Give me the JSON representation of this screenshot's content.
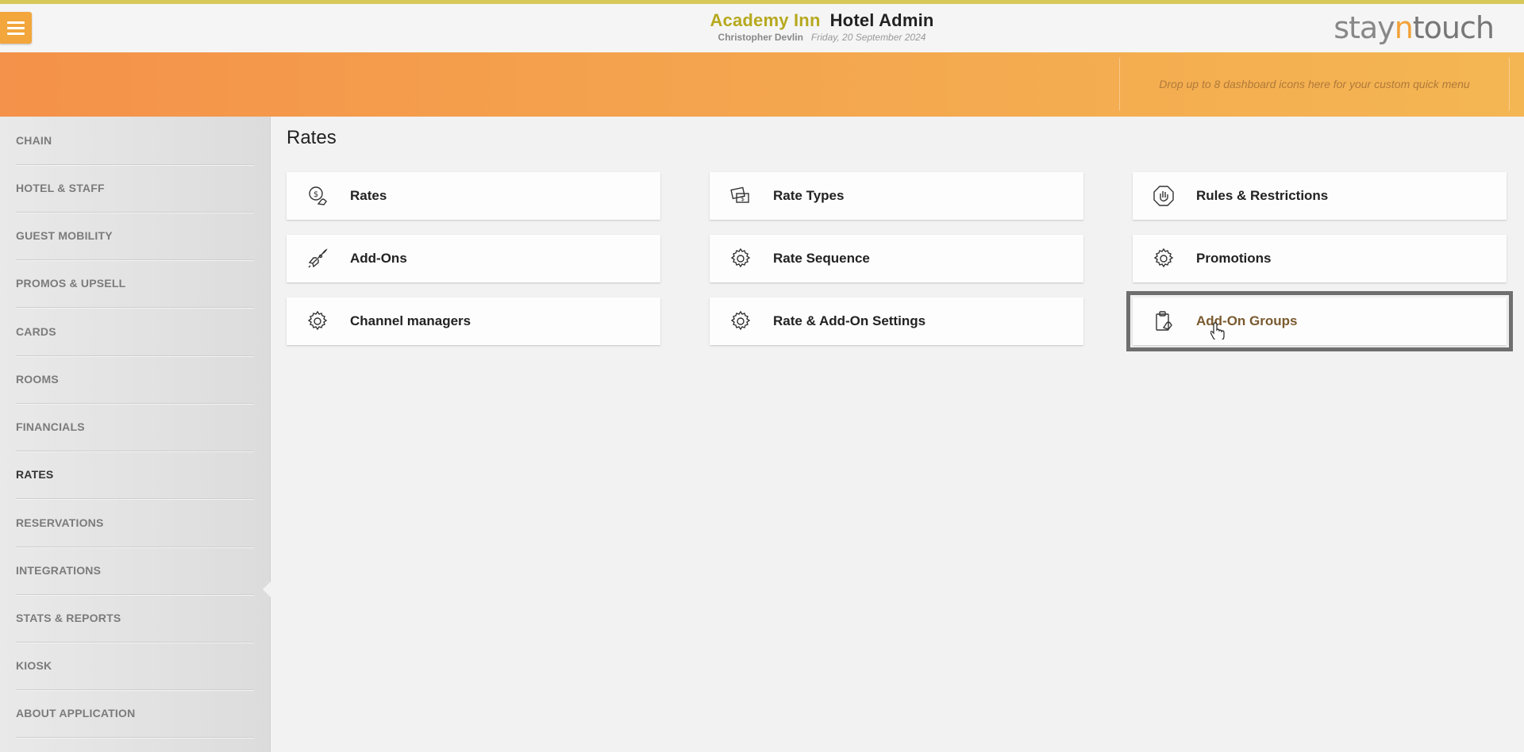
{
  "header": {
    "hotel_name": "Academy Inn",
    "app_name": "Hotel Admin",
    "user_name": "Christopher Devlin",
    "date": "Friday, 20 September 2024",
    "logo": {
      "part1": "stay",
      "part2": "n",
      "part3": "touch"
    },
    "menu_icon": "hamburger-icon"
  },
  "banner": {
    "quick_menu_hint": "Drop up to 8 dashboard icons here for your custom quick menu"
  },
  "sidebar": {
    "items": [
      {
        "label": "CHAIN"
      },
      {
        "label": "HOTEL & STAFF"
      },
      {
        "label": "GUEST MOBILITY"
      },
      {
        "label": "PROMOS & UPSELL"
      },
      {
        "label": "CARDS"
      },
      {
        "label": "ROOMS"
      },
      {
        "label": "FINANCIALS"
      },
      {
        "label": "RATES",
        "active": true
      },
      {
        "label": "RESERVATIONS"
      },
      {
        "label": "INTEGRATIONS"
      },
      {
        "label": "STATS & REPORTS"
      },
      {
        "label": "KIOSK"
      },
      {
        "label": "ABOUT APPLICATION"
      }
    ]
  },
  "main": {
    "title": "Rates",
    "cards": [
      {
        "label": "Rates",
        "icon": "dollar-hand-icon"
      },
      {
        "label": "Rate Types",
        "icon": "money-bills-icon"
      },
      {
        "label": "Rules & Restrictions",
        "icon": "stop-hand-icon"
      },
      {
        "label": "Add-Ons",
        "icon": "rocket-icon"
      },
      {
        "label": "Rate Sequence",
        "icon": "gear-icon"
      },
      {
        "label": "Promotions",
        "icon": "gear-icon"
      },
      {
        "label": "Channel managers",
        "icon": "gear-icon"
      },
      {
        "label": "Rate & Add-On Settings",
        "icon": "gear-icon"
      },
      {
        "label": "Add-On Groups",
        "icon": "clipboard-hand-icon",
        "selected": true
      }
    ]
  },
  "colors": {
    "accent": "#f3a63b",
    "hotel_name": "#b6a91f",
    "banner_start": "#f4914a",
    "banner_end": "#f4b653",
    "selection_outline": "#6f6f6f"
  }
}
